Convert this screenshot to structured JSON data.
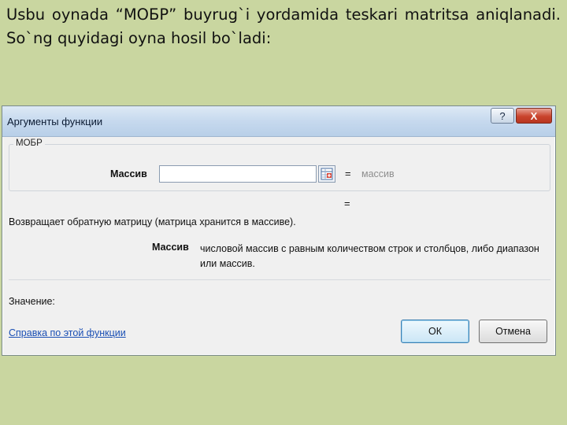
{
  "slide": {
    "text": "Usbu oynada “МОБР” buyrug`i yordamida teskari matritsa aniqlanadi. So`ng quyidagi oyna hosil bo`ladi:"
  },
  "dialog": {
    "title": "Аргументы функции",
    "help_button": "?",
    "close_button": "X",
    "function_name": "МОБР",
    "argument": {
      "label": "Массив",
      "value": "",
      "equals": "=",
      "result_hint": "массив"
    },
    "result_equals": "=",
    "description": "Возвращает обратную матрицу (матрица хранится в массиве).",
    "arg_help": {
      "name": "Массив",
      "text": "числовой массив с равным количеством строк и столбцов, либо диапазон или массив."
    },
    "value_label": "Значение:",
    "help_link": "Справка по этой функции",
    "ok_label": "ОК",
    "cancel_label": "Отмена"
  }
}
